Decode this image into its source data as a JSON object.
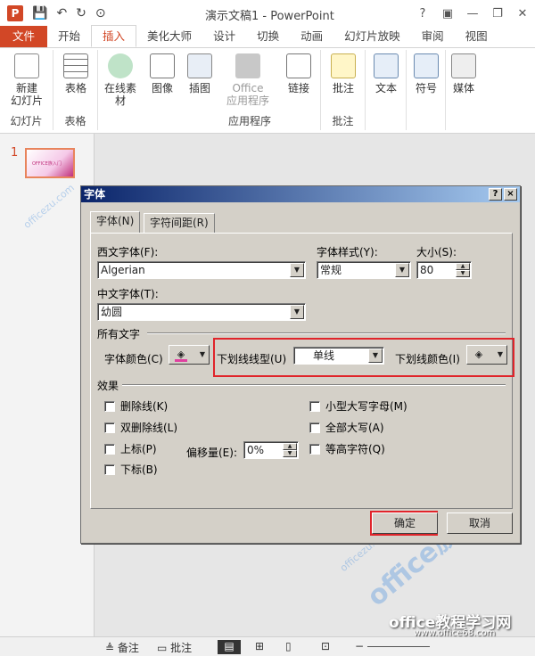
{
  "window": {
    "app_icon": "P",
    "title": "演示文稿1 - PowerPoint",
    "help": "?",
    "minimize": "—",
    "restore": "❐",
    "close": "✕"
  },
  "qat": {
    "save_icon": "save-icon",
    "undo_icon": "undo-icon",
    "redo_icon": "redo-icon",
    "customize_icon": "present-icon"
  },
  "tabs": [
    "文件",
    "开始",
    "插入",
    "美化大师",
    "设计",
    "切换",
    "动画",
    "幻灯片放映",
    "审阅",
    "视图"
  ],
  "active_tab": "插入",
  "ribbon": {
    "new_slide": "新建\n幻灯片",
    "table": "表格",
    "online_material": "在线素\n材",
    "image": "图像",
    "illustration": "插图",
    "office_apps": "Office\n应用程序",
    "link": "链接",
    "comment": "批注",
    "text": "文本",
    "symbol": "符号",
    "media": "媒体",
    "groups": {
      "slides": "幻灯片",
      "tables": "表格",
      "apps": "应用程序",
      "comments": "批注"
    }
  },
  "thumbnails": {
    "slide_number": "1",
    "thumb_text": "OFFICE族入门"
  },
  "dialog": {
    "title": "字体",
    "help_btn": "?",
    "close_btn": "×",
    "tabs": [
      "字体(N)",
      "字符间距(R)"
    ],
    "latin_font_label": "西文字体(F):",
    "latin_font_value": "Algerian",
    "font_style_label": "字体样式(Y):",
    "font_style_value": "常规",
    "size_label": "大小(S):",
    "size_value": "80",
    "asian_font_label": "中文字体(T):",
    "asian_font_value": "幼圆",
    "all_text_label": "所有文字",
    "font_color_label": "字体颜色(C)",
    "underline_style_label": "下划线线型(U)",
    "underline_style_value": "单线",
    "underline_color_label": "下划线颜色(I)",
    "effects_label": "效果",
    "effects_left": [
      "删除线(K)",
      "双删除线(L)",
      "上标(P)",
      "下标(B)"
    ],
    "effects_right": [
      "小型大写字母(M)",
      "全部大写(A)",
      "等高字符(Q)"
    ],
    "offset_label": "偏移量(E):",
    "offset_value": "0%",
    "ok": "确定",
    "cancel": "取消"
  },
  "status": {
    "notes": "备注",
    "comments": "批注"
  },
  "watermark": {
    "text": "office族",
    "url": "officezu.com",
    "site": "office教程学习网",
    "site_url": "www.office68.com"
  }
}
